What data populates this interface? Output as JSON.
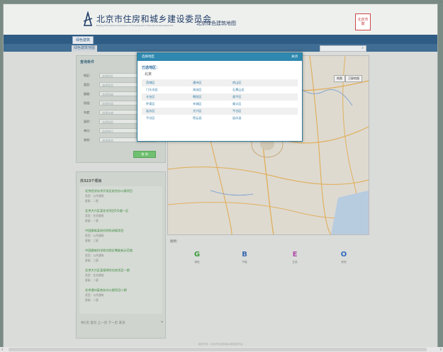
{
  "header": {
    "org_title": "北京市住房和城乡建设委员会",
    "org_subtitle": "Beijing Municipal Commission of Housing and Urban-Rural Development",
    "site_title": "北京绿色建筑地图",
    "seal_text": "北京市徽"
  },
  "nav": {
    "tab": "绿色建筑"
  },
  "subnav": {
    "tab": "绿色建筑地图",
    "search_placeholder": ""
  },
  "filter": {
    "title": "查询条件",
    "rows": [
      {
        "label": "地区：",
        "value": "选择地区"
      },
      {
        "label": "类型：",
        "value": "选择类型"
      },
      {
        "label": "星级：",
        "value": "选择星级"
      },
      {
        "label": "阶段：",
        "value": "选择阶段"
      },
      {
        "label": "年度：",
        "value": "选择年度"
      },
      {
        "label": "面积：",
        "value": "选择面积"
      },
      {
        "label": "单位：",
        "value": "选择单位"
      },
      {
        "label": "其他：",
        "value": "选择其他"
      }
    ],
    "search_button": "查 询"
  },
  "list": {
    "title": "共323个项目",
    "items": [
      {
        "name": "北京经济技术开发区综合办公楼项目",
        "attr1": "类型：公共建筑",
        "attr2": "星级：二星"
      },
      {
        "name": "北京大兴区某住宅项目5号楼一区",
        "attr1": "类型：住宅建筑",
        "attr2": "星级：一星"
      },
      {
        "name": "中国建筑某研究院科研楼项目",
        "attr1": "类型：公共建筑",
        "attr2": "星级：三星"
      },
      {
        "name": "中国建筑科学研究院近零能耗示范楼",
        "attr1": "类型：公共建筑",
        "attr2": "星级：三星"
      },
      {
        "name": "北京大兴区某保障性住房项目一期",
        "attr1": "类型：住宅建筑",
        "attr2": "星级：二星"
      },
      {
        "name": "北京通州某商务办公楼项目二期",
        "attr1": "类型：公共建筑",
        "attr2": "星级：二星"
      }
    ],
    "pager": "共1页 首页 上一页 下一页 末页"
  },
  "map": {
    "type_buttons": [
      "地图",
      "卫星地图"
    ],
    "legend_title": "图例：",
    "legend": [
      {
        "letter": "G",
        "label": "绿色",
        "color": "#3a9a3a"
      },
      {
        "letter": "B",
        "label": "节能",
        "color": "#3a6ab0"
      },
      {
        "letter": "E",
        "label": "生态",
        "color": "#b04aa8"
      },
      {
        "letter": "O",
        "label": "其他",
        "color": "#2e6ac0"
      }
    ]
  },
  "modal": {
    "title": "选择地区",
    "close_label": "关闭",
    "selected_label": "已选地区：",
    "current": "北京",
    "districts": [
      [
        "西城区",
        "通州区",
        "房山区"
      ],
      [
        "门头沟区",
        "海淀区",
        "石景山区"
      ],
      [
        "丰台区",
        "朝阳区",
        "昌平区"
      ],
      [
        "怀柔区",
        "东城区",
        "顺义区"
      ],
      [
        "延庆区",
        "大兴区",
        "平谷区"
      ],
      [
        "平谷区",
        "密云县",
        "延庆县"
      ]
    ]
  },
  "footer": {
    "copyright": "版权所有：北京市住房和城乡建设委员会"
  }
}
